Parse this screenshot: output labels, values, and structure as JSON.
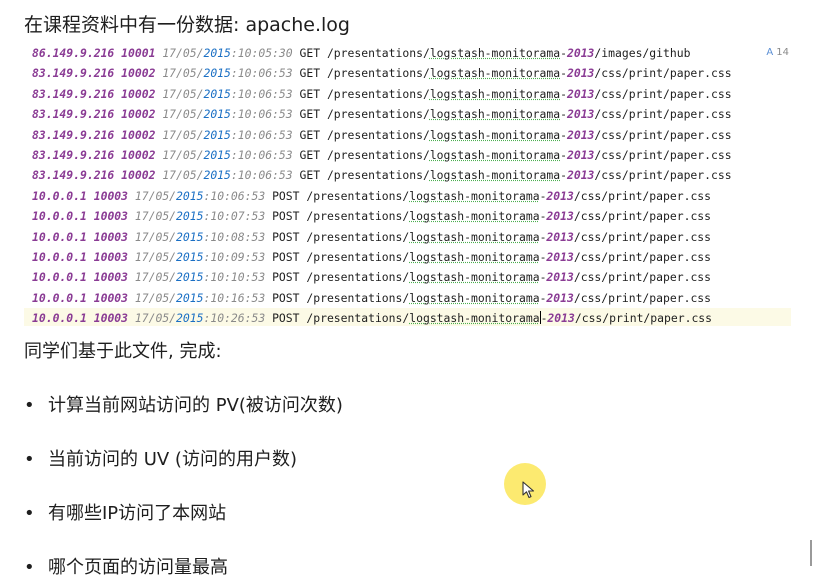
{
  "heading": "在课程资料中有一份数据: apache.log",
  "log_lines": [
    {
      "ip": "86.149.9.216",
      "uid": "10001",
      "date_a": "17/05/",
      "date_b": "2015",
      "time": ":10:05:30",
      "method": "GET",
      "path_a": "/presentations/",
      "path_b": "logstash-monitorama",
      "path_c": "-",
      "year": "2013",
      "path_d": "/images/github"
    },
    {
      "ip": "83.149.9.216",
      "uid": "10002",
      "date_a": "17/05/",
      "date_b": "2015",
      "time": ":10:06:53",
      "method": "GET",
      "path_a": "/presentations/",
      "path_b": "logstash-monitorama",
      "path_c": "-",
      "year": "2013",
      "path_d": "/css/print/paper.css"
    },
    {
      "ip": "83.149.9.216",
      "uid": "10002",
      "date_a": "17/05/",
      "date_b": "2015",
      "time": ":10:06:53",
      "method": "GET",
      "path_a": "/presentations/",
      "path_b": "logstash-monitorama",
      "path_c": "-",
      "year": "2013",
      "path_d": "/css/print/paper.css"
    },
    {
      "ip": "83.149.9.216",
      "uid": "10002",
      "date_a": "17/05/",
      "date_b": "2015",
      "time": ":10:06:53",
      "method": "GET",
      "path_a": "/presentations/",
      "path_b": "logstash-monitorama",
      "path_c": "-",
      "year": "2013",
      "path_d": "/css/print/paper.css"
    },
    {
      "ip": "83.149.9.216",
      "uid": "10002",
      "date_a": "17/05/",
      "date_b": "2015",
      "time": ":10:06:53",
      "method": "GET",
      "path_a": "/presentations/",
      "path_b": "logstash-monitorama",
      "path_c": "-",
      "year": "2013",
      "path_d": "/css/print/paper.css"
    },
    {
      "ip": "83.149.9.216",
      "uid": "10002",
      "date_a": "17/05/",
      "date_b": "2015",
      "time": ":10:06:53",
      "method": "GET",
      "path_a": "/presentations/",
      "path_b": "logstash-monitorama",
      "path_c": "-",
      "year": "2013",
      "path_d": "/css/print/paper.css"
    },
    {
      "ip": "83.149.9.216",
      "uid": "10002",
      "date_a": "17/05/",
      "date_b": "2015",
      "time": ":10:06:53",
      "method": "GET",
      "path_a": "/presentations/",
      "path_b": "logstash-monitorama",
      "path_c": "-",
      "year": "2013",
      "path_d": "/css/print/paper.css"
    },
    {
      "ip": "10.0.0.1",
      "uid": "10003",
      "date_a": "17/05/",
      "date_b": "2015",
      "time": ":10:06:53",
      "method": "POST",
      "path_a": "/presentations/",
      "path_b": "logstash-monitorama",
      "path_c": "-",
      "year": "2013",
      "path_d": "/css/print/paper.css"
    },
    {
      "ip": "10.0.0.1",
      "uid": "10003",
      "date_a": "17/05/",
      "date_b": "2015",
      "time": ":10:07:53",
      "method": "POST",
      "path_a": "/presentations/",
      "path_b": "logstash-monitorama",
      "path_c": "-",
      "year": "2013",
      "path_d": "/css/print/paper.css"
    },
    {
      "ip": "10.0.0.1",
      "uid": "10003",
      "date_a": "17/05/",
      "date_b": "2015",
      "time": ":10:08:53",
      "method": "POST",
      "path_a": "/presentations/",
      "path_b": "logstash-monitorama",
      "path_c": "-",
      "year": "2013",
      "path_d": "/css/print/paper.css"
    },
    {
      "ip": "10.0.0.1",
      "uid": "10003",
      "date_a": "17/05/",
      "date_b": "2015",
      "time": ":10:09:53",
      "method": "POST",
      "path_a": "/presentations/",
      "path_b": "logstash-monitorama",
      "path_c": "-",
      "year": "2013",
      "path_d": "/css/print/paper.css"
    },
    {
      "ip": "10.0.0.1",
      "uid": "10003",
      "date_a": "17/05/",
      "date_b": "2015",
      "time": ":10:10:53",
      "method": "POST",
      "path_a": "/presentations/",
      "path_b": "logstash-monitorama",
      "path_c": "-",
      "year": "2013",
      "path_d": "/css/print/paper.css"
    },
    {
      "ip": "10.0.0.1",
      "uid": "10003",
      "date_a": "17/05/",
      "date_b": "2015",
      "time": ":10:16:53",
      "method": "POST",
      "path_a": "/presentations/",
      "path_b": "logstash-monitorama",
      "path_c": "-",
      "year": "2013",
      "path_d": "/css/print/paper.css"
    },
    {
      "ip": "10.0.0.1",
      "uid": "10003",
      "date_a": "17/05/",
      "date_b": "2015",
      "time": ":10:26:53",
      "method": "POST",
      "path_a": "/presentations/",
      "path_b": "logstash-monitorama",
      "path_c": "-",
      "year": "2013",
      "path_d": "/css/print/paper.css"
    }
  ],
  "inspection_badge": {
    "icon": "typo-icon",
    "glyph": "A",
    "count": "14"
  },
  "intro": "同学们基于此文件, 完成:",
  "tasks": [
    "计算当前网站访问的 PV(被访问次数)",
    "当前访问的 UV (访问的用户数)",
    "有哪些IP访问了本网站",
    "哪个页面的访问量最高"
  ],
  "bullet_glyph": "•",
  "colors": {
    "ip_uid": "#8a3b94",
    "date": "#8a8a8a",
    "date_year": "#1a6fc4",
    "current_line": "#fcfae6",
    "cursor_halo": "#fce860"
  },
  "editor": {
    "current_line_index": 13
  }
}
